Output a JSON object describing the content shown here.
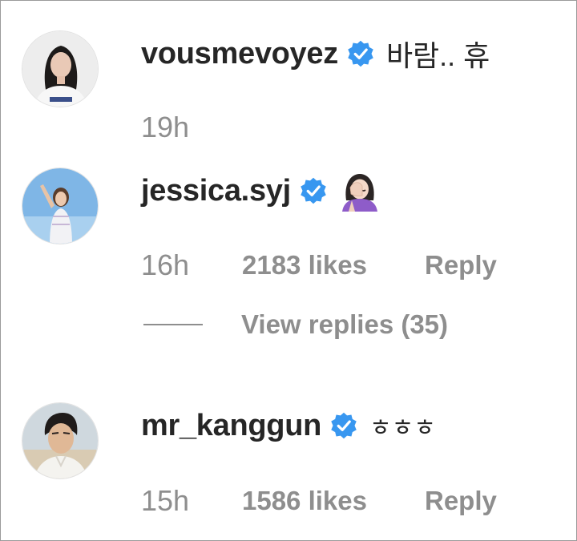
{
  "comments": [
    {
      "username": "vousmevoyez",
      "verified": true,
      "text": "바람.. 휴",
      "time": "19h",
      "avatar_icon": "avatar-photo-woman-white-shirt"
    },
    {
      "username": "jessica.syj",
      "verified": true,
      "text": "",
      "emoji": "woman-facepalming-emoji",
      "time": "16h",
      "likes": "2183 likes",
      "reply_label": "Reply",
      "view_replies": "View replies (35)",
      "avatar_icon": "avatar-photo-woman-blue-sky"
    },
    {
      "username": "mr_kanggun",
      "verified": true,
      "text": "ㅎㅎㅎ",
      "time": "15h",
      "likes": "1586 likes",
      "reply_label": "Reply",
      "avatar_icon": "avatar-photo-man-beach"
    }
  ],
  "colors": {
    "username": "#262626",
    "meta": "#8e8e8e",
    "verified_badge": "#3897f0"
  }
}
